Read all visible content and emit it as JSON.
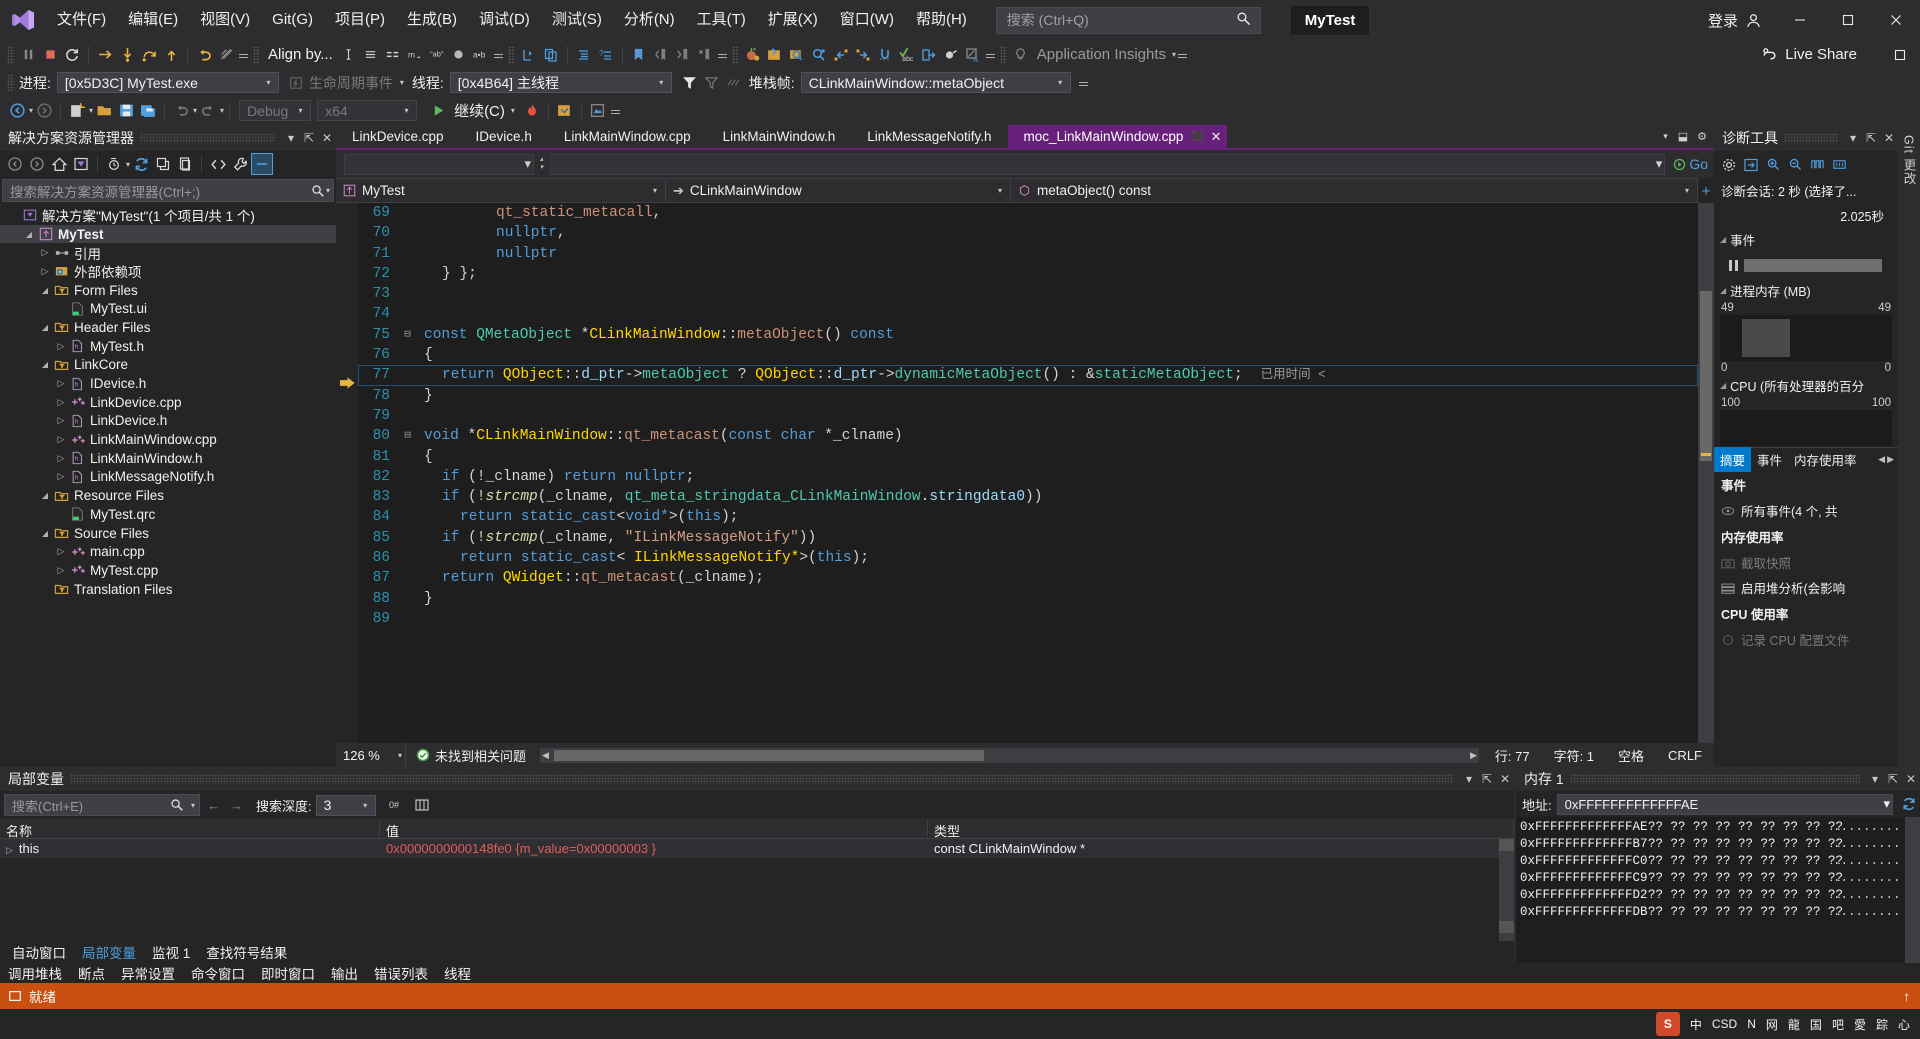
{
  "window": {
    "project_badge": "MyTest",
    "login_label": "登录",
    "search_placeholder": "搜索 (Ctrl+Q)",
    "live_share": "Live Share"
  },
  "menu": [
    {
      "label": "文件(F)"
    },
    {
      "label": "编辑(E)"
    },
    {
      "label": "视图(V)"
    },
    {
      "label": "Git(G)"
    },
    {
      "label": "项目(P)"
    },
    {
      "label": "生成(B)"
    },
    {
      "label": "调试(D)"
    },
    {
      "label": "测试(S)"
    },
    {
      "label": "分析(N)"
    },
    {
      "label": "工具(T)"
    },
    {
      "label": "扩展(X)"
    },
    {
      "label": "窗口(W)"
    },
    {
      "label": "帮助(H)"
    }
  ],
  "toolbar": {
    "align_by": "Align by...",
    "app_insights": "Application Insights"
  },
  "debugbar": {
    "process_label": "进程:",
    "process_value": "[0x5D3C] MyTest.exe",
    "lifecycle_label": "生命周期事件",
    "thread_label": "线程:",
    "thread_value": "[0x4B64] 主线程",
    "stackframe_label": "堆栈帧:",
    "stackframe_value": "CLinkMainWindow::metaObject"
  },
  "runbar": {
    "config": "Debug",
    "platform": "x64",
    "continue_label": "继续(C)"
  },
  "solution_explorer": {
    "title": "解决方案资源管理器",
    "search_placeholder": "搜索解决方案资源管理器(Ctrl+;)",
    "tree": [
      {
        "label": "解决方案\"MyTest\"(1 个项目/共 1 个)",
        "depth": 0,
        "arrow": "",
        "icon": "solution-icon",
        "bold": false,
        "selected": false
      },
      {
        "label": "MyTest",
        "depth": 1,
        "arrow": "▴",
        "icon": "project-icon",
        "bold": true,
        "selected": true
      },
      {
        "label": "引用",
        "depth": 2,
        "arrow": "▸",
        "icon": "references-icon",
        "bold": false,
        "selected": false
      },
      {
        "label": "外部依赖项",
        "depth": 2,
        "arrow": "▸",
        "icon": "ext-dep-icon",
        "bold": false,
        "selected": false
      },
      {
        "label": "Form Files",
        "depth": 2,
        "arrow": "▴",
        "icon": "filter-folder-icon",
        "bold": false,
        "selected": false
      },
      {
        "label": "MyTest.ui",
        "depth": 3,
        "arrow": "",
        "icon": "ui-file-icon",
        "bold": false,
        "selected": false
      },
      {
        "label": "Header Files",
        "depth": 2,
        "arrow": "▴",
        "icon": "filter-folder-icon",
        "bold": false,
        "selected": false
      },
      {
        "label": "MyTest.h",
        "depth": 3,
        "arrow": "▸",
        "icon": "h-file-icon",
        "bold": false,
        "selected": false
      },
      {
        "label": "LinkCore",
        "depth": 2,
        "arrow": "▴",
        "icon": "filter-folder-icon",
        "bold": false,
        "selected": false
      },
      {
        "label": "IDevice.h",
        "depth": 3,
        "arrow": "▸",
        "icon": "h-file-icon",
        "bold": false,
        "selected": false
      },
      {
        "label": "LinkDevice.cpp",
        "depth": 3,
        "arrow": "▸",
        "icon": "cpp-file-icon",
        "bold": false,
        "selected": false
      },
      {
        "label": "LinkDevice.h",
        "depth": 3,
        "arrow": "▸",
        "icon": "h-file-icon",
        "bold": false,
        "selected": false
      },
      {
        "label": "LinkMainWindow.cpp",
        "depth": 3,
        "arrow": "▸",
        "icon": "cpp-file-icon",
        "bold": false,
        "selected": false
      },
      {
        "label": "LinkMainWindow.h",
        "depth": 3,
        "arrow": "▸",
        "icon": "h-file-icon",
        "bold": false,
        "selected": false
      },
      {
        "label": "LinkMessageNotify.h",
        "depth": 3,
        "arrow": "▸",
        "icon": "h-file-icon",
        "bold": false,
        "selected": false
      },
      {
        "label": "Resource Files",
        "depth": 2,
        "arrow": "▴",
        "icon": "filter-folder-icon",
        "bold": false,
        "selected": false
      },
      {
        "label": "MyTest.qrc",
        "depth": 3,
        "arrow": "",
        "icon": "qrc-file-icon",
        "bold": false,
        "selected": false
      },
      {
        "label": "Source Files",
        "depth": 2,
        "arrow": "▴",
        "icon": "filter-folder-icon",
        "bold": false,
        "selected": false
      },
      {
        "label": "main.cpp",
        "depth": 3,
        "arrow": "▸",
        "icon": "cpp-file-icon",
        "bold": false,
        "selected": false
      },
      {
        "label": "MyTest.cpp",
        "depth": 3,
        "arrow": "▸",
        "icon": "cpp-file-icon",
        "bold": false,
        "selected": false
      },
      {
        "label": "Translation Files",
        "depth": 2,
        "arrow": "",
        "icon": "filter-folder-icon",
        "bold": false,
        "selected": false
      }
    ]
  },
  "editor": {
    "tabs": [
      {
        "label": "LinkDevice.cpp",
        "active": false
      },
      {
        "label": "IDevice.h",
        "active": false
      },
      {
        "label": "LinkMainWindow.cpp",
        "active": false
      },
      {
        "label": "LinkMainWindow.h",
        "active": false
      },
      {
        "label": "LinkMessageNotify.h",
        "active": false
      },
      {
        "label": "moc_LinkMainWindow.cpp",
        "active": true
      }
    ],
    "go_label": "Go",
    "nav_project": "MyTest",
    "nav_class": "CLinkMainWindow",
    "nav_member": "metaObject() const",
    "zoom": "126 %",
    "issue_status": "未找到相关问题",
    "row_label": "行: 77",
    "col_label": "字符: 1",
    "space_label": "空格",
    "eol_label": "CRLF",
    "inline_timing": "已用时间 <",
    "lines": [
      {
        "num": "69",
        "indent": 4,
        "tokens": [
          {
            "t": "qt_static_metacall",
            "c": "mac"
          },
          {
            "t": ",",
            "c": "p"
          }
        ]
      },
      {
        "num": "70",
        "indent": 4,
        "tokens": [
          {
            "t": "nullptr",
            "c": "k"
          },
          {
            "t": ",",
            "c": "p"
          }
        ]
      },
      {
        "num": "71",
        "indent": 4,
        "tokens": [
          {
            "t": "nullptr",
            "c": "k"
          }
        ]
      },
      {
        "num": "72",
        "indent": 1,
        "tokens": [
          {
            "t": "} };",
            "c": "p"
          }
        ]
      },
      {
        "num": "73",
        "indent": 0,
        "tokens": []
      },
      {
        "num": "74",
        "indent": 0,
        "tokens": []
      },
      {
        "num": "75",
        "indent": 0,
        "fold": "-",
        "tokens": [
          {
            "t": "const ",
            "c": "k"
          },
          {
            "t": "QMetaObject ",
            "c": "t"
          },
          {
            "t": "*",
            "c": "p"
          },
          {
            "t": "CLinkMainWindow",
            "c": "cls"
          },
          {
            "t": "::",
            "c": "p"
          },
          {
            "t": "metaObject",
            "c": "mac"
          },
          {
            "t": "() ",
            "c": "p"
          },
          {
            "t": "const",
            "c": "k"
          }
        ]
      },
      {
        "num": "76",
        "indent": 0,
        "tokens": [
          {
            "t": "{",
            "c": "p"
          }
        ]
      },
      {
        "num": "77",
        "indent": 1,
        "current": true,
        "tokens": [
          {
            "t": "return ",
            "c": "k"
          },
          {
            "t": "QObject",
            "c": "cls"
          },
          {
            "t": "::",
            "c": "p"
          },
          {
            "t": "d_ptr",
            "c": "id"
          },
          {
            "t": "->",
            "c": "p"
          },
          {
            "t": "metaObject ",
            "c": "t"
          },
          {
            "t": "? ",
            "c": "p"
          },
          {
            "t": "QObject",
            "c": "cls"
          },
          {
            "t": "::",
            "c": "p"
          },
          {
            "t": "d_ptr",
            "c": "id"
          },
          {
            "t": "->",
            "c": "p"
          },
          {
            "t": "dynamicMetaObject",
            "c": "t"
          },
          {
            "t": "() : &",
            "c": "p"
          },
          {
            "t": "staticMetaObject",
            "c": "t"
          },
          {
            "t": ";",
            "c": "p"
          }
        ]
      },
      {
        "num": "78",
        "indent": 0,
        "tokens": [
          {
            "t": "}",
            "c": "p"
          }
        ]
      },
      {
        "num": "79",
        "indent": 0,
        "tokens": []
      },
      {
        "num": "80",
        "indent": 0,
        "fold": "-",
        "tokens": [
          {
            "t": "void ",
            "c": "k"
          },
          {
            "t": "*",
            "c": "p"
          },
          {
            "t": "CLinkMainWindow",
            "c": "cls"
          },
          {
            "t": "::",
            "c": "p"
          },
          {
            "t": "qt_metacast",
            "c": "mac"
          },
          {
            "t": "(",
            "c": "p"
          },
          {
            "t": "const char ",
            "c": "k"
          },
          {
            "t": "*_clname)",
            "c": "p"
          }
        ]
      },
      {
        "num": "81",
        "indent": 0,
        "tokens": [
          {
            "t": "{",
            "c": "p"
          }
        ]
      },
      {
        "num": "82",
        "indent": 1,
        "tokens": [
          {
            "t": "if ",
            "c": "k"
          },
          {
            "t": "(!_clname) ",
            "c": "p"
          },
          {
            "t": "return ",
            "c": "k"
          },
          {
            "t": "nullptr",
            "c": "k"
          },
          {
            "t": ";",
            "c": "p"
          }
        ]
      },
      {
        "num": "83",
        "indent": 1,
        "tokens": [
          {
            "t": "if ",
            "c": "k"
          },
          {
            "t": "(!",
            "c": "p"
          },
          {
            "t": "strcmp",
            "c": "fnI"
          },
          {
            "t": "(_clname, ",
            "c": "p"
          },
          {
            "t": "qt_meta_stringdata_CLinkMainWindow",
            "c": "t"
          },
          {
            "t": ".",
            "c": "p"
          },
          {
            "t": "stringdata0",
            "c": "id"
          },
          {
            "t": "))",
            "c": "p"
          }
        ]
      },
      {
        "num": "84",
        "indent": 2,
        "tokens": [
          {
            "t": "return ",
            "c": "k"
          },
          {
            "t": "static_cast",
            "c": "k"
          },
          {
            "t": "<",
            "c": "p"
          },
          {
            "t": "void*",
            "c": "k"
          },
          {
            "t": ">(",
            "c": "p"
          },
          {
            "t": "this",
            "c": "k"
          },
          {
            "t": ");",
            "c": "p"
          }
        ]
      },
      {
        "num": "85",
        "indent": 1,
        "tokens": [
          {
            "t": "if ",
            "c": "k"
          },
          {
            "t": "(!",
            "c": "p"
          },
          {
            "t": "strcmp",
            "c": "fnI"
          },
          {
            "t": "(_clname, ",
            "c": "p"
          },
          {
            "t": "\"ILinkMessageNotify\"",
            "c": "s"
          },
          {
            "t": "))",
            "c": "p"
          }
        ]
      },
      {
        "num": "86",
        "indent": 2,
        "tokens": [
          {
            "t": "return ",
            "c": "k"
          },
          {
            "t": "static_cast",
            "c": "k"
          },
          {
            "t": "< ",
            "c": "p"
          },
          {
            "t": "ILinkMessageNotify*",
            "c": "cls"
          },
          {
            "t": ">(",
            "c": "p"
          },
          {
            "t": "this",
            "c": "k"
          },
          {
            "t": ");",
            "c": "p"
          }
        ]
      },
      {
        "num": "87",
        "indent": 1,
        "tokens": [
          {
            "t": "return ",
            "c": "k"
          },
          {
            "t": "QWidget",
            "c": "cls"
          },
          {
            "t": "::",
            "c": "p"
          },
          {
            "t": "qt_metacast",
            "c": "mac"
          },
          {
            "t": "(_clname);",
            "c": "p"
          }
        ]
      },
      {
        "num": "88",
        "indent": 0,
        "tokens": [
          {
            "t": "}",
            "c": "p"
          }
        ]
      },
      {
        "num": "89",
        "indent": 0,
        "tokens": []
      }
    ]
  },
  "diagnostics": {
    "title": "诊断工具",
    "session_label": "诊断会话: 2 秒 (选择了...",
    "elapsed": "2.025秒",
    "events_section": "事件",
    "memory_section": "进程内存 (MB)",
    "mem_top_left": "49",
    "mem_top_right": "49",
    "mem_bot_left": "0",
    "mem_bot_right": "0",
    "cpu_section": "CPU (所有处理器的百分",
    "cpu_top_left": "100",
    "cpu_top_right": "100",
    "tabs": [
      {
        "label": "摘要",
        "active": true
      },
      {
        "label": "事件",
        "active": false
      },
      {
        "label": "内存使用率",
        "active": false
      }
    ],
    "events_header": "事件",
    "events_row": "所有事件(4 个, 共",
    "mem_header": "内存使用率",
    "mem_snapshot": "截取快照",
    "mem_heap": "启用堆分析(会影响",
    "cpu_header": "CPU 使用率",
    "cpu_record": "记录 CPU 配置文件",
    "side_strip": "Git 更改"
  },
  "locals": {
    "title": "局部变量",
    "search_placeholder": "搜索(Ctrl+E)",
    "depth_label": "搜索深度:",
    "depth_value": "3",
    "columns": [
      "名称",
      "值",
      "类型"
    ],
    "rows": [
      {
        "name": "this",
        "value": "0x0000000000148fe0 {m_value=0x00000003 }",
        "type": "const CLinkMainWindow *"
      }
    ],
    "tabs": [
      {
        "label": "自动窗口",
        "active": false
      },
      {
        "label": "局部变量",
        "active": true
      },
      {
        "label": "监视 1",
        "active": false
      },
      {
        "label": "查找符号结果",
        "active": false
      }
    ]
  },
  "memory": {
    "title": "内存 1",
    "address_label": "地址:",
    "address_value": "0xFFFFFFFFFFFFFAE",
    "rows": [
      {
        "addr": "0xFFFFFFFFFFFFFAE",
        "hex": "?? ?? ?? ?? ?? ?? ?? ?? ??",
        "ascii": "........."
      },
      {
        "addr": "0xFFFFFFFFFFFFFB7",
        "hex": "?? ?? ?? ?? ?? ?? ?? ?? ??",
        "ascii": "........."
      },
      {
        "addr": "0xFFFFFFFFFFFFFC0",
        "hex": "?? ?? ?? ?? ?? ?? ?? ?? ??",
        "ascii": "........."
      },
      {
        "addr": "0xFFFFFFFFFFFFFC9",
        "hex": "?? ?? ?? ?? ?? ?? ?? ?? ??",
        "ascii": "........."
      },
      {
        "addr": "0xFFFFFFFFFFFFFD2",
        "hex": "?? ?? ?? ?? ?? ?? ?? ?? ??",
        "ascii": "........."
      },
      {
        "addr": "0xFFFFFFFFFFFFFDB",
        "hex": "?? ?? ?? ?? ?? ?? ?? ?? ??",
        "ascii": "........."
      }
    ]
  },
  "bottom_tabs": [
    {
      "label": "调用堆栈"
    },
    {
      "label": "断点"
    },
    {
      "label": "异常设置"
    },
    {
      "label": "命令窗口"
    },
    {
      "label": "即时窗口"
    },
    {
      "label": "输出"
    },
    {
      "label": "错误列表"
    },
    {
      "label": "线程"
    }
  ],
  "statusbar": {
    "ready": "就绪"
  },
  "tray": {
    "ime": "中",
    "items": [
      "CSD",
      "N",
      "网",
      "龍",
      "国",
      "吧",
      "愛",
      "踪",
      "心"
    ]
  },
  "colors": {
    "accent_purple": "#68217a",
    "status_orange": "#ca5010",
    "tab_active_bg": "#68217a",
    "panel_bg": "#252526",
    "editor_bg": "#1e1e1e",
    "chrome_bg": "#2d2d30",
    "link_blue": "#4ea0e0",
    "linenum_blue": "#2b91af"
  }
}
